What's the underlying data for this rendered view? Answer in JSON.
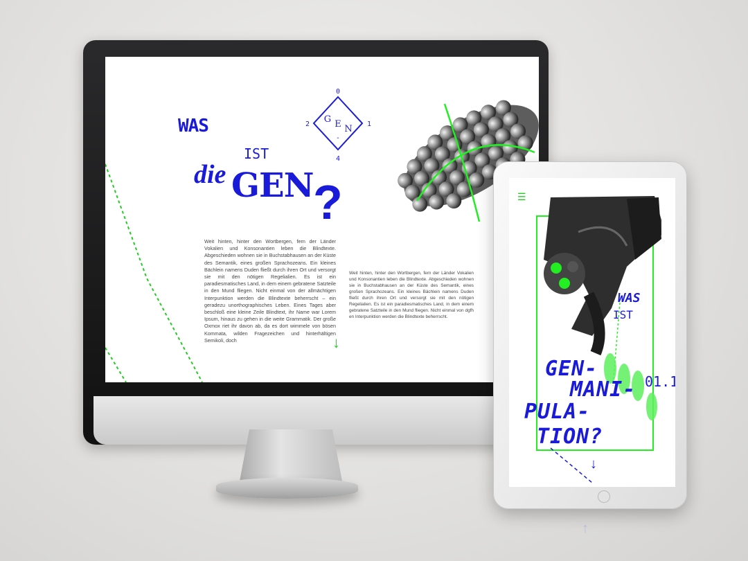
{
  "colors": {
    "accent_blue": "#1a1ad9",
    "accent_green": "#22cc22"
  },
  "desktop": {
    "heading": {
      "was": "WAS",
      "ist": "IST",
      "die": "die",
      "gen": "GEN",
      "question": "?"
    },
    "logo": {
      "top": "0",
      "left": "2",
      "right": "1",
      "bottom": "4",
      "letters": [
        "G",
        "E",
        "N",
        "-"
      ]
    },
    "paragraph_1": "Weit hinten, hinter den Wortbergen, fern der Länder Vokalien und Konsonantien leben die Blindtexte. Abgeschieden wohnen sie in Buchstabhausen an der Küste des Semantik, eines großen Sprachozeans. Ein kleines Bächlein namens Duden fließt durch ihren Ort und versorgt sie mit den nötigen Regelialien. Es ist ein paradiesmatisches Land, in dem einem gebratene Satzteile in den Mund fliegen. Nicht einmal von der allmächtigen Interpunktion werden die Blindtexte beherrscht – ein geradezu unorthographisches Leben. Eines Tages aber beschloß eine kleine Zeile Blindtext, ihr Name war Lorem Ipsum, hinaus zu gehen in die weite Grammatik. Der große Oxmox riet ihr davon ab, da es dort wimmele von bösen Kommata, wilden Fragezeichen und hinterhältigen Semikoli, doch",
    "paragraph_2": "Weit hinten, hinter den Wortbergen, fern der Länder Vokalien und Konsonantien leben die Blindtexte. Abgeschieden wohnen sie in Buchstabhausen an der Küste des Semantik, eines großen Sprachozeans. Ein kleines Bächlein namens Duden fließt durch ihren Ort und versorgt sie mit den nötigen Regelialien. Es ist ein paradiesmatisches Land, in dem einem gebratene Satzteile in den Mund fliegen. Nicht einmal von dgfh en Interpunktion werden die Blindtexte beherrscht.",
    "scroll_arrow": "↓",
    "illustration": "corn-cob-icon"
  },
  "tablet": {
    "menu_icon": "☰",
    "was": "WAS",
    "ist": "IST",
    "lines": [
      "GEN-",
      "MANI-",
      "PULA-",
      "TION?"
    ],
    "number": "01.1",
    "scroll_arrow": "↓",
    "reflection_arrow": "↑",
    "illustration": "revolver-icon"
  }
}
